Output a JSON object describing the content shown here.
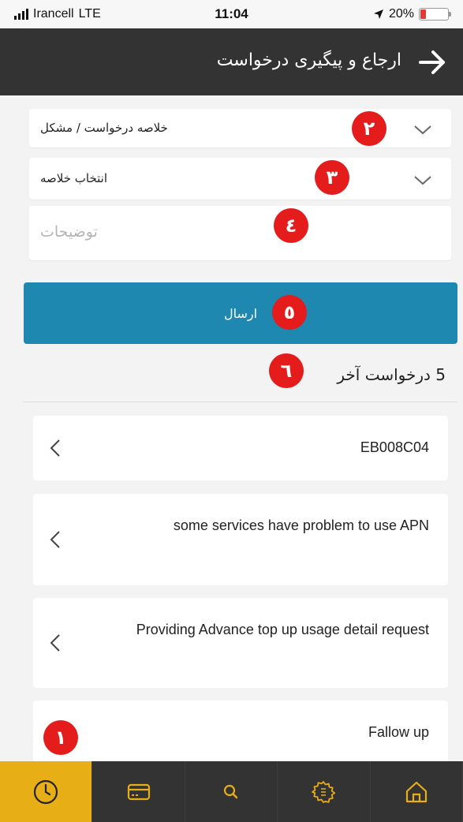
{
  "status_bar": {
    "carrier": "Irancell",
    "network": "LTE",
    "time": "11:04",
    "battery": "20%",
    "battery_level": 0.2
  },
  "header": {
    "title": "ارجاع و پیگیری درخواست",
    "back_icon": "arrow-right-icon"
  },
  "form": {
    "summary_label": "خلاصه درخواست / مشکل",
    "select_summary_label": "انتخاب خلاصه",
    "description_placeholder": "توضیحات",
    "send_label": "ارسال"
  },
  "recent": {
    "title": "5 درخواست آخر",
    "items": [
      "EB008C04",
      "some services have problem to use APN",
      "Providing Advance top up usage detail request",
      "Fallow up"
    ]
  },
  "badges": {
    "b1": "١",
    "b2": "٢",
    "b3": "٣",
    "b4": "٤",
    "b5": "٥",
    "b6": "٦"
  },
  "bottom_nav": {
    "items": [
      "clock-icon",
      "card-icon",
      "search-icon",
      "gear-icon",
      "home-icon"
    ],
    "active": "clock-icon"
  },
  "colors": {
    "header_bg": "#333333",
    "accent_blue": "#1e88b0",
    "active_nav": "#e8ae16",
    "badge_red": "#e41c1c",
    "battery_red": "#e53935"
  }
}
